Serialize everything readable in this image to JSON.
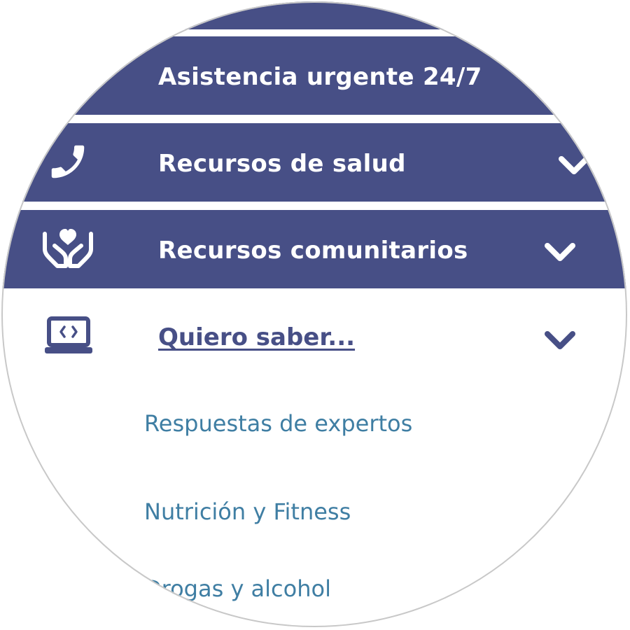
{
  "menu": {
    "items": [
      {
        "label": "Asistencia urgente 24/7"
      },
      {
        "label": "Recursos de salud",
        "icon": "phone-icon"
      },
      {
        "label": "Recursos comunitarios",
        "icon": "helping-hands-heart-icon"
      },
      {
        "label": "Quiero saber...",
        "icon": "laptop-code-icon",
        "expanded": true
      }
    ],
    "subitems": [
      {
        "label": "Respuestas de expertos"
      },
      {
        "label": "Nutrición y Fitness"
      },
      {
        "label": "Drogas y alcohol"
      }
    ]
  },
  "colors": {
    "band": "#474f86",
    "band_text": "#ffffff",
    "active_label": "#474f86",
    "subitem_text": "#3f7ea3"
  }
}
